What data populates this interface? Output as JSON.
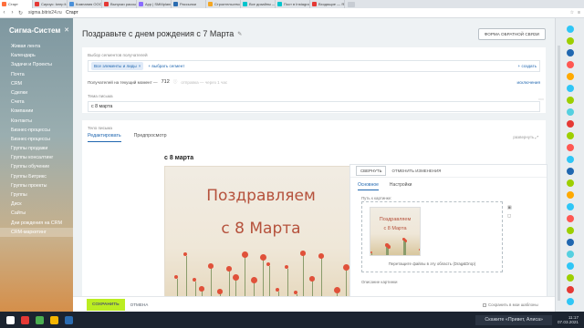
{
  "browser": {
    "tabs": [
      {
        "label": "Старт",
        "color": "#ff6f3c",
        "active": true
      },
      {
        "label": "Сириус: keep it...",
        "color": "#e53935"
      },
      {
        "label": "Компания ООО \"Сиг...",
        "color": "#4a90d9"
      },
      {
        "label": "Выпуски рассылк...",
        "color": "#e53935"
      },
      {
        "label": "App | SMMplanner",
        "color": "#8a6cff"
      },
      {
        "label": "Рассылки",
        "color": "#2b6cb0"
      },
      {
        "label": "Строительство домо...",
        "color": "#f4a623"
      },
      {
        "label": "Все дизайны — Canv...",
        "color": "#00c4cc"
      },
      {
        "label": "Пост в Instagram —...",
        "color": "#00c4cc"
      },
      {
        "label": "Входящие — Яндекс...",
        "color": "#e53935"
      }
    ],
    "url_host": "sigma.bitrix24.ru",
    "url_path": "Старт"
  },
  "sidebar": {
    "brand": "Сигма-Систем",
    "items": [
      {
        "label": "Живая лента"
      },
      {
        "label": "Календарь"
      },
      {
        "label": "Задачи и Проекты"
      },
      {
        "label": "Почта"
      },
      {
        "label": "CRM"
      },
      {
        "label": "Сделки"
      },
      {
        "label": "Счета"
      },
      {
        "label": "Компании"
      },
      {
        "label": "Контакты"
      },
      {
        "label": "Бизнес-процессы"
      },
      {
        "label": "Бизнес-процессы"
      },
      {
        "label": "Группы продажи"
      },
      {
        "label": "Группы консалтинг"
      },
      {
        "label": "Группы обучение"
      },
      {
        "label": "Группы Битрикс"
      },
      {
        "label": "Группы проекты"
      },
      {
        "label": "Группы"
      },
      {
        "label": "Диск"
      },
      {
        "label": "Сайты"
      },
      {
        "label": "Дни рождения на CRM"
      },
      {
        "label": "CRM-маркетинг"
      }
    ]
  },
  "main": {
    "title": "Поздравьте с днем рождения с 7 Марта",
    "feedback_button": "ФОРМА ОБРАТНОЙ СВЯЗИ",
    "recipients_label": "Выбор сегментов получателей",
    "chip_label": "Все элементы и лиды",
    "add_segment": "+ выбрать сегмент",
    "create_label": "+ создать",
    "count_label": "Получателей на текущий момент —",
    "count_value": "712",
    "count_hint": "отправка — через 1 час",
    "exceptions_label": "исключения",
    "subject_label": "Тема письма",
    "subject_value": "с 8 марта",
    "letter_label": "Тело письма",
    "editor_tabs": [
      "Редактировать",
      "Предпросмотр"
    ],
    "expand_label": "развернуть",
    "canvas_heading": "с 8 марта",
    "postcard_line1": "Поздравляем",
    "postcard_line2": "с 8 Марта"
  },
  "panel": {
    "collapse_button": "СВЕРНУТЬ",
    "undo_label": "ОТМЕНИТЬ ИЗМЕНЕНИЯ",
    "tabs": [
      "Основное",
      "Настройки"
    ],
    "path_label": "Путь к картинке:",
    "thumb_line1": "Поздравляем",
    "thumb_line2": "с 8 Марта",
    "drop_text": "Перетащите файлы в эту область (Drag&Drop)",
    "description_label": "Описание картинки"
  },
  "footer": {
    "save_button": "СОХРАНИТЬ",
    "cancel_label": "ОТМЕНА",
    "save_template": "Сохранить в мои шаблоны"
  },
  "taskbar": {
    "search_text": "Скажите «Привет, Алиса»",
    "time": "11:17",
    "date": "07.03.2021"
  },
  "colors": {
    "accent_blue": "#2067b0",
    "save_green": "#bbed21",
    "postcard_text": "#b5513c"
  }
}
